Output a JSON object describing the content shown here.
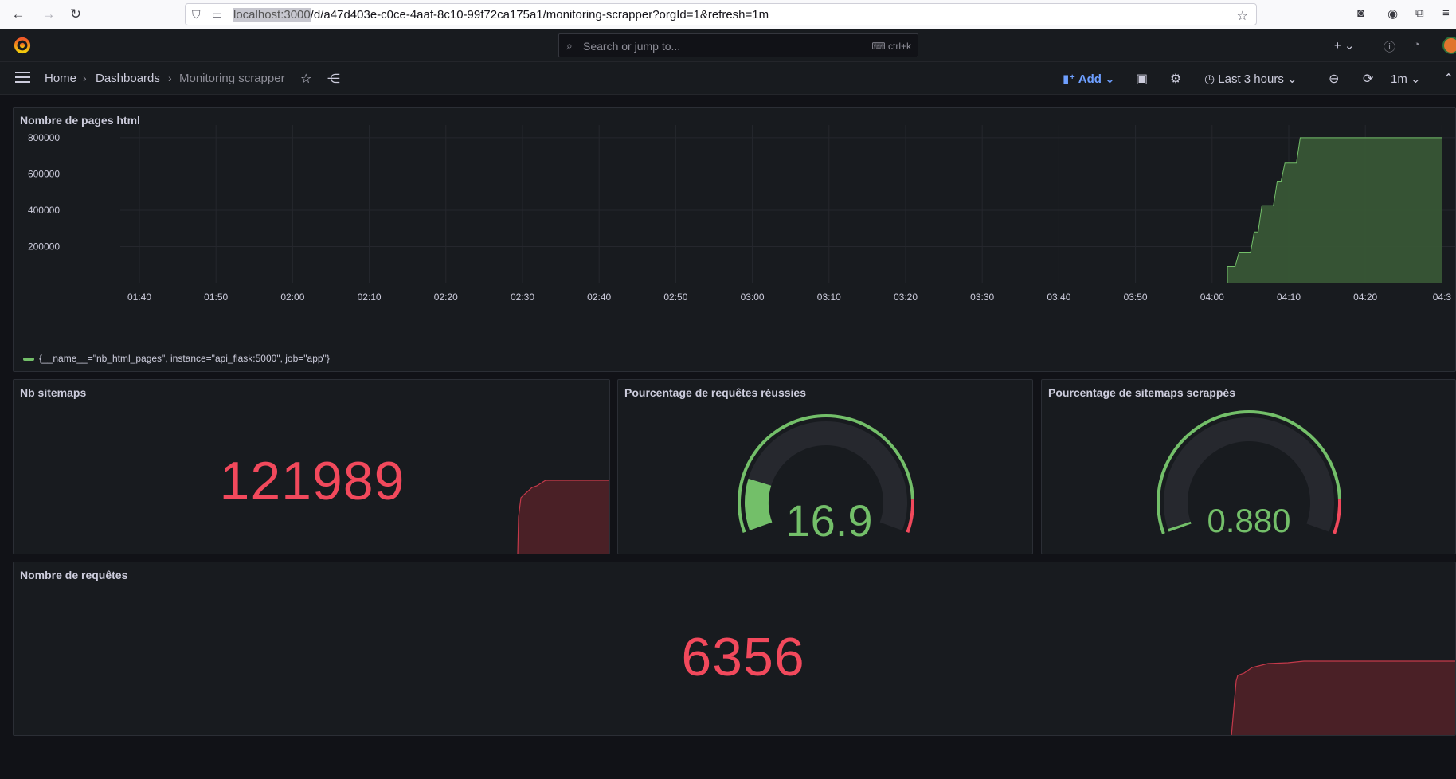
{
  "browser": {
    "url_host": "localhost:3000",
    "url_path": "/d/a47d403e-c0ce-4aaf-8c10-99f72ca175a1/monitoring-scrapper?orgId=1&refresh=1m"
  },
  "topbar": {
    "search_placeholder": "Search or jump to...",
    "search_shortcut": "ctrl+k",
    "new_label": "+"
  },
  "breadcrumb": {
    "home": "Home",
    "dashboards": "Dashboards",
    "current": "Monitoring scrapper"
  },
  "toolbar": {
    "add_label": "Add",
    "time_range": "Last 3 hours",
    "refresh_interval": "1m"
  },
  "panels": {
    "html_pages": {
      "title": "Nombre de pages html",
      "legend": "{__name__=\"nb_html_pages\", instance=\"api_flask:5000\", job=\"app\"}"
    },
    "sitemaps": {
      "title": "Nb sitemaps",
      "value": "121989"
    },
    "requests_success": {
      "title": "Pourcentage de requêtes réussies",
      "value": "16.9",
      "fraction": 0.169
    },
    "sitemaps_scraped": {
      "title": "Pourcentage de sitemaps scrappés",
      "value": "0.880",
      "fraction": 0.0088
    },
    "requests": {
      "title": "Nombre de requêtes",
      "value": "6356"
    }
  },
  "colors": {
    "green": "#73bf69",
    "red": "#f2495c",
    "panel_bg": "#181b1f",
    "page_bg": "#111217",
    "accent_blue": "#6e9fff"
  },
  "chart_data": {
    "type": "area",
    "title": "Nombre de pages html",
    "x": [
      "01:40",
      "01:50",
      "02:00",
      "02:10",
      "02:20",
      "02:30",
      "02:40",
      "02:50",
      "03:00",
      "03:10",
      "03:20",
      "03:30",
      "03:40",
      "03:50",
      "04:00",
      "04:10",
      "04:20",
      "04:3"
    ],
    "yticks": [
      "200000",
      "400000",
      "600000",
      "800000"
    ],
    "ylim": [
      0,
      870000
    ],
    "series": [
      {
        "name": "{__name__=\"nb_html_pages\", instance=\"api_flask:5000\", job=\"app\"}",
        "points": [
          {
            "t": "04:02",
            "v": 90000
          },
          {
            "t": "04:03",
            "v": 90000
          },
          {
            "t": "04:03.5",
            "v": 165000
          },
          {
            "t": "04:05",
            "v": 165000
          },
          {
            "t": "04:05.5",
            "v": 280000
          },
          {
            "t": "04:06",
            "v": 280000
          },
          {
            "t": "04:06.5",
            "v": 425000
          },
          {
            "t": "04:08",
            "v": 425000
          },
          {
            "t": "04:08.5",
            "v": 560000
          },
          {
            "t": "04:09",
            "v": 560000
          },
          {
            "t": "04:09.5",
            "v": 660000
          },
          {
            "t": "04:11",
            "v": 660000
          },
          {
            "t": "04:11.5",
            "v": 800000
          },
          {
            "t": "04:30",
            "v": 800000
          }
        ]
      }
    ],
    "grid": true,
    "legend": "bottom-left"
  }
}
